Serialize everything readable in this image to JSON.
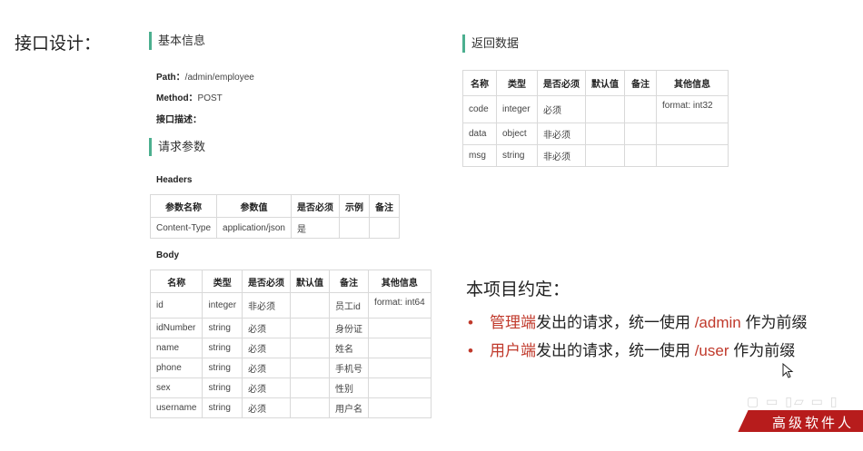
{
  "page_label": "接口设计：",
  "basic_info": {
    "title": "基本信息",
    "path_label": "Path：",
    "path_value": "/admin/employee",
    "method_label": "Method：",
    "method_value": "POST",
    "desc_label": "接口描述："
  },
  "request_params": {
    "title": "请求参数",
    "headers_label": "Headers",
    "headers_table": {
      "columns": [
        "参数名称",
        "参数值",
        "是否必须",
        "示例",
        "备注"
      ],
      "rows": [
        [
          "Content-Type",
          "application/json",
          "是",
          "",
          ""
        ]
      ]
    },
    "body_label": "Body",
    "body_table": {
      "columns": [
        "名称",
        "类型",
        "是否必须",
        "默认值",
        "备注",
        "其他信息"
      ],
      "rows": [
        [
          "id",
          "integer",
          "非必须",
          "",
          "员工id",
          "format: int64"
        ],
        [
          "idNumber",
          "string",
          "必须",
          "",
          "身份证",
          ""
        ],
        [
          "name",
          "string",
          "必须",
          "",
          "姓名",
          ""
        ],
        [
          "phone",
          "string",
          "必须",
          "",
          "手机号",
          ""
        ],
        [
          "sex",
          "string",
          "必须",
          "",
          "性别",
          ""
        ],
        [
          "username",
          "string",
          "必须",
          "",
          "用户名",
          ""
        ]
      ]
    }
  },
  "response": {
    "title": "返回数据",
    "table": {
      "columns": [
        "名称",
        "类型",
        "是否必须",
        "默认值",
        "备注",
        "其他信息"
      ],
      "rows": [
        [
          "code",
          "integer",
          "必须",
          "",
          "",
          "format: int32"
        ],
        [
          "data",
          "object",
          "非必须",
          "",
          "",
          ""
        ],
        [
          "msg",
          "string",
          "非必须",
          "",
          "",
          ""
        ]
      ]
    }
  },
  "convention": {
    "title": "本项目约定：",
    "items": [
      {
        "highlight": "管理端",
        "mid": "发出的请求，统一使用 ",
        "path": "/admin",
        "tail": " 作为前缀"
      },
      {
        "highlight": "用户端",
        "mid": "发出的请求，统一使用 ",
        "path": "/user",
        "tail": " 作为前缀"
      }
    ]
  },
  "banner_text": "高级软件人才",
  "colors": {
    "accent_bar": "#4caf8f",
    "highlight_red": "#c0392b",
    "banner_red": "#b71c1c"
  }
}
